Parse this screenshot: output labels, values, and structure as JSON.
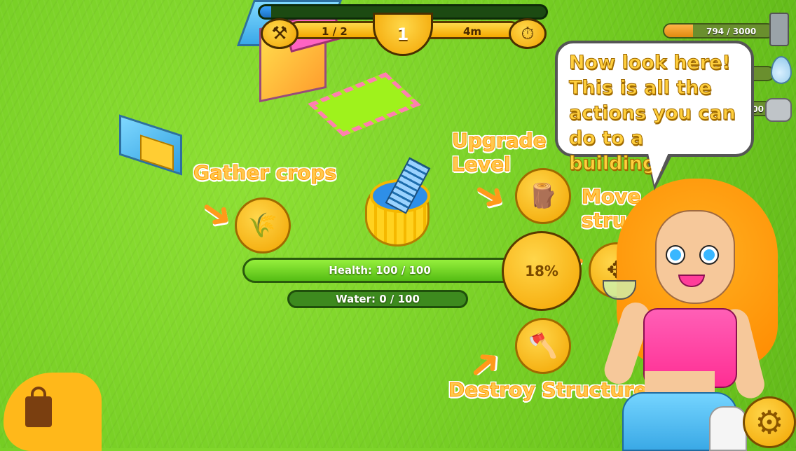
{
  "top_bar": {
    "xp_progress": 0.04,
    "workers": "1 / 2",
    "level": "1",
    "timer": "4m",
    "hammer_icon": "hammer-icon",
    "stopwatch_icon": "stopwatch-icon"
  },
  "resources": {
    "gold": {
      "text": "794 / 3000",
      "fill": 0.26,
      "icon": "gold-bucket-icon"
    },
    "water": {
      "text": "",
      "icon": "water-drop-icon"
    },
    "stone": {
      "text": "00",
      "icon": "stone-pile-icon"
    }
  },
  "labels": {
    "gather": "Gather crops",
    "upgrade_line1": "Upgrade",
    "upgrade_line2": "Level",
    "move_line1": "Move",
    "move_line2": "structure",
    "destroy": "Destroy Structure"
  },
  "building_status": {
    "health": "Health: 100 / 100",
    "water": "Water: 0 / 100",
    "progress": "18%"
  },
  "speech_bubble": {
    "line1": "Now look here!",
    "line2": "This is all the",
    "line3": "actions you can",
    "line4": "do to a building."
  },
  "icons": {
    "gather": "wheat-sickle-icon",
    "upgrade": "wood-planks-icon",
    "move": "move-arrows-icon",
    "destroy": "axe-icon",
    "shop": "shopping-bag-icon",
    "settings": "gear-icon"
  },
  "colors": {
    "grass": "#7fd52a",
    "button_gold": "#f2a400",
    "label_orange": "#ffc84d",
    "health_green": "#55bd14"
  }
}
